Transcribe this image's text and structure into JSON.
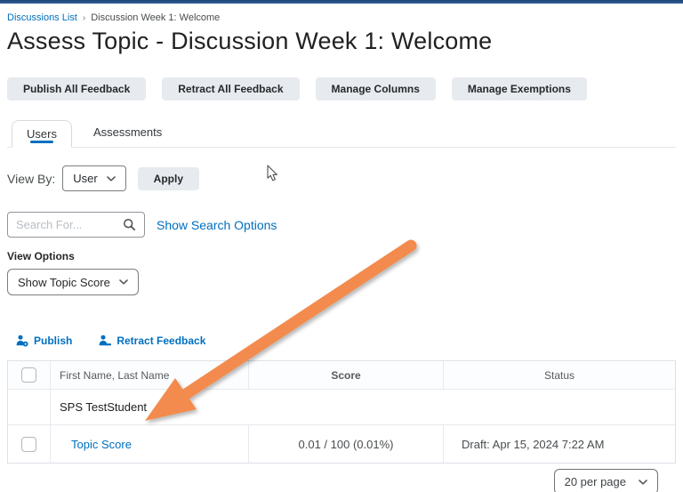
{
  "breadcrumb": {
    "link": "Discussions List",
    "separator": "›",
    "current": "Discussion Week 1: Welcome"
  },
  "page": {
    "title": "Assess Topic - Discussion Week 1: Welcome"
  },
  "toolbar": {
    "buttons": [
      "Publish All Feedback",
      "Retract All Feedback",
      "Manage Columns",
      "Manage Exemptions"
    ]
  },
  "tabs": {
    "users": "Users",
    "assessments": "Assessments"
  },
  "view_by": {
    "label": "View By:",
    "selected": "User",
    "apply_label": "Apply"
  },
  "search": {
    "placeholder": "Search For...",
    "show_options_label": "Show Search Options"
  },
  "view_options": {
    "label": "View Options",
    "selected": "Show Topic Score"
  },
  "actions": {
    "publish_label": "Publish",
    "retract_label": "Retract Feedback"
  },
  "table": {
    "headers": {
      "name": "First Name, Last Name",
      "score": "Score",
      "status": "Status"
    },
    "group_row": {
      "name": "SPS TestStudent"
    },
    "rows": [
      {
        "link": "Topic Score",
        "score": "0.01 / 100 (0.01%)",
        "status": "Draft: Apr 15, 2024 7:22 AM"
      }
    ]
  },
  "pager": {
    "selected": "20 per page"
  },
  "colors": {
    "link_blue": "#006fbf",
    "arrow_orange": "#f28b4e",
    "topbar_navy": "#31619c",
    "button_gray": "#e7eaee"
  }
}
